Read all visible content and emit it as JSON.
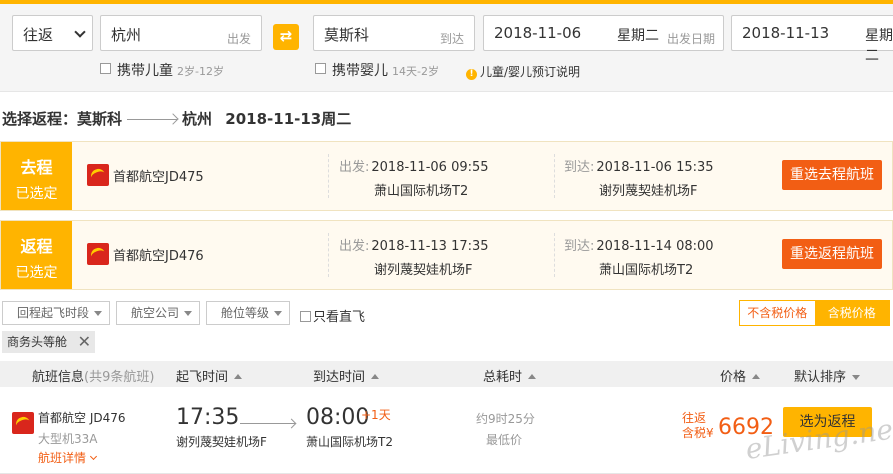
{
  "search": {
    "trip_type": "往返",
    "from_city": "杭州",
    "from_hint": "出发",
    "swap_icon": "⇄",
    "to_city": "莫斯科",
    "to_hint": "到达",
    "depart_date": "2018-11-06",
    "depart_weekday": "星期二",
    "depart_hint": "出发日期",
    "return_date": "2018-11-13",
    "return_weekday": "星期二",
    "child_label": "携带儿童",
    "child_age": "2岁-12岁",
    "infant_label": "携带婴儿",
    "infant_age": "14天-2岁",
    "info_icon": "!",
    "info_text": "儿童/婴儿预订说明"
  },
  "route": {
    "prefix": "选择返程：",
    "from": "莫斯科",
    "to": "杭州",
    "date": "2018-11-13周二"
  },
  "legs": [
    {
      "tag_title": "去程",
      "tag_status": "已选定",
      "airline": "首都航空JD475",
      "dep_label": "出发:",
      "dep_time": "2018-11-06 09:55",
      "dep_airport": "萧山国际机场T2",
      "arr_label": "到达:",
      "arr_time": "2018-11-06 15:35",
      "arr_airport": "谢列蔑契娃机场F",
      "button": "重选去程航班"
    },
    {
      "tag_title": "返程",
      "tag_status": "已选定",
      "airline": "首都航空JD476",
      "dep_label": "出发:",
      "dep_time": "2018-11-13 17:35",
      "dep_airport": "谢列蔑契娃机场F",
      "arr_label": "到达:",
      "arr_time": "2018-11-14 08:00",
      "arr_airport": "萧山国际机场T2",
      "button": "重选返程航班"
    }
  ],
  "filters": {
    "time": "回程起飞时段",
    "airline": "航空公司",
    "cabin": "舱位等级",
    "direct": "只看直飞",
    "price_excl": "不含税价格",
    "price_incl": "含税价格",
    "chip": "商务头等舱",
    "chip_close": "✕"
  },
  "list_header": {
    "info": "航班信息",
    "info_sub": "(共9条航班)",
    "dep": "起飞时间",
    "arr": "到达时间",
    "dur": "总耗时",
    "price": "价格",
    "sort": "默认排序"
  },
  "flight": {
    "airline": "首都航空 JD476",
    "plane": "大型机33A",
    "details": "航班详情",
    "dep_time": "17:35",
    "dep_airport": "谢列蔑契娃机场F",
    "arr_time": "08:00",
    "arr_plus": "+1天",
    "arr_airport": "萧山国际机场T2",
    "duration": "约9时25分",
    "lowest": "最低价",
    "price_type_1": "往返",
    "price_type_2": "含税",
    "currency": "¥",
    "price": "6692",
    "cta": "选为返程"
  },
  "watermark": "eLiving.net",
  "colors": {
    "accent": "#ffb400",
    "action": "#f25e14",
    "airline_red": "#d9261c"
  }
}
